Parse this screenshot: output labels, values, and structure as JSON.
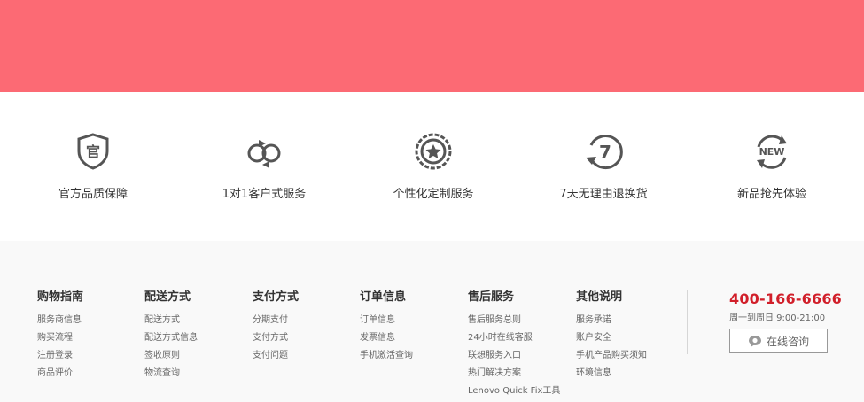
{
  "features": [
    {
      "label": "官方品质保障",
      "icon": "official-shield-icon"
    },
    {
      "label": "1对1客户式服务",
      "icon": "one-on-one-icon"
    },
    {
      "label": "个性化定制服务",
      "icon": "custom-star-badge-icon"
    },
    {
      "label": "7天无理由退换货",
      "icon": "seven-day-return-icon"
    },
    {
      "label": "新品抢先体验",
      "icon": "new-product-icon"
    }
  ],
  "icon_glyphs": {
    "official": "官",
    "seven": "7",
    "new": "NEW"
  },
  "columns": [
    {
      "title": "购物指南",
      "links": [
        "服务商信息",
        "购买流程",
        "注册登录",
        "商品评价"
      ]
    },
    {
      "title": "配送方式",
      "links": [
        "配送方式",
        "配送方式信息",
        "签收原则",
        "物流查询"
      ]
    },
    {
      "title": "支付方式",
      "links": [
        "分期支付",
        "支付方式",
        "支付问题"
      ]
    },
    {
      "title": "订单信息",
      "links": [
        "订单信息",
        "发票信息",
        "手机激活查询"
      ]
    },
    {
      "title": "售后服务",
      "links": [
        "售后服务总则",
        "24小时在线客服",
        "联想服务入口",
        "热门解决方案",
        "Lenovo Quick Fix工具"
      ]
    },
    {
      "title": "其他说明",
      "links": [
        "服务承诺",
        "账户安全",
        "手机产品购买须知",
        "环境信息"
      ]
    }
  ],
  "contact": {
    "phone": "400-166-6666",
    "hours": "周一到周日 9:00-21:00",
    "consult_label": "在线咨询",
    "consult_icon": "chat-bubble-icon"
  },
  "colors": {
    "banner": "#fc6a74",
    "phone": "#d11f2a",
    "icon": "#555555"
  }
}
